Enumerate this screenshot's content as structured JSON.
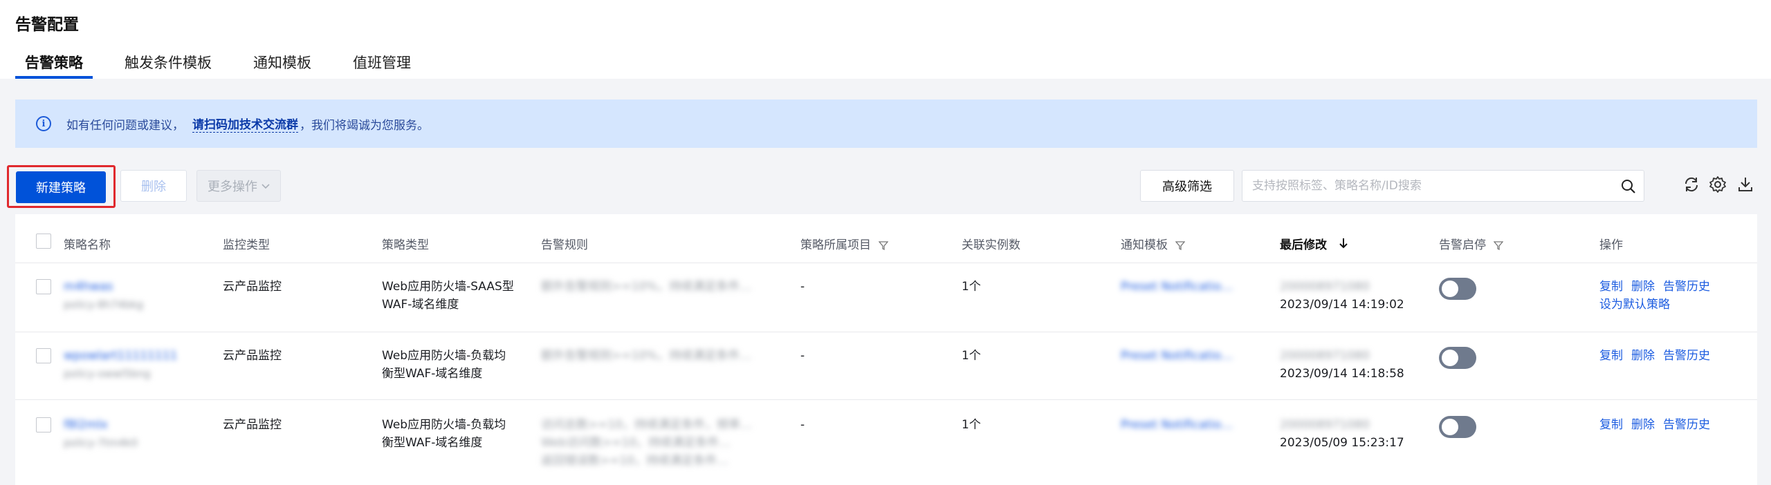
{
  "page": {
    "title": "告警配置"
  },
  "tabs": [
    {
      "label": "告警策略",
      "active": true
    },
    {
      "label": "触发条件模板",
      "active": false
    },
    {
      "label": "通知模板",
      "active": false
    },
    {
      "label": "值班管理",
      "active": false
    }
  ],
  "notice": {
    "text_before": "如有任何问题或建议，",
    "link": "请扫码加技术交流群",
    "text_after": "，我们将竭诚为您服务。"
  },
  "toolbar": {
    "new_label": "新建策略",
    "delete_label": "删除",
    "more_label": "更多操作",
    "filter_label": "高级筛选",
    "search_placeholder": "支持按照标签、策略名称/ID搜索"
  },
  "table": {
    "columns": {
      "name": "策略名称",
      "monitor_type": "监控类型",
      "policy_type": "策略类型",
      "rule": "告警规则",
      "project": "策略所属项目",
      "instances": "关联实例数",
      "notice_template": "通知模板",
      "modified": "最后修改",
      "enabled": "告警启停",
      "actions": "操作"
    },
    "rows": [
      {
        "name": "m4hwas",
        "id": "policy-8h74bkg",
        "monitor_type": "云产品监控",
        "policy_type_1": "Web应用防火墙-SAAS型",
        "policy_type_2": "WAF-域名维度",
        "rule_1": "额外告警规则>=10%，持续满足条件…",
        "rule_2": "",
        "rule_3": "",
        "project": "-",
        "instances": "1个",
        "notice_template": "Preset Notificatio…",
        "modifier": "200008971080",
        "modified": "2023/09/14 14:19:02",
        "enabled": false,
        "action_copy": "复制",
        "action_delete": "删除",
        "action_history": "告警历史",
        "action_default": "设为默认策略"
      },
      {
        "name": "wpowlart11111111",
        "id": "policy-owwl5bng",
        "monitor_type": "云产品监控",
        "policy_type_1": "Web应用防火墙-负载均",
        "policy_type_2": "衡型WAF-域名维度",
        "rule_1": "额外告警规则>=10%，持续满足条件…",
        "rule_2": "",
        "rule_3": "",
        "project": "-",
        "instances": "1个",
        "notice_template": "Preset Notificatio…",
        "modifier": "200008971080",
        "modified": "2023/09/14 14:18:58",
        "enabled": false,
        "action_copy": "复制",
        "action_delete": "删除",
        "action_history": "告警历史",
        "action_default": ""
      },
      {
        "name": "f8l2mlx",
        "id": "policy-7tm4k0",
        "monitor_type": "云产品监控",
        "policy_type_1": "Web应用防火墙-负载均",
        "policy_type_2": "衡型WAF-域名维度",
        "rule_1": "访问总数>=10，持续满足条件，频率…",
        "rule_2": "Web访问数>=10，持续满足条件…",
        "rule_3": "返回错误数>=10，持续满足条件…",
        "project": "-",
        "instances": "1个",
        "notice_template": "Preset Notificatio…",
        "modifier": "200008971080",
        "modified": "2023/05/09 15:23:17",
        "enabled": false,
        "action_copy": "复制",
        "action_delete": "删除",
        "action_history": "告警历史",
        "action_default": ""
      }
    ]
  },
  "colors": {
    "primary": "#0052d9",
    "highlight_border": "#e0292e",
    "notice_bg": "#d5e6fe",
    "toggle_off": "#6f7a8d"
  }
}
